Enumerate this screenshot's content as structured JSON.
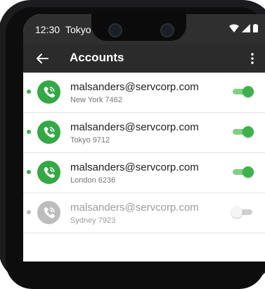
{
  "status_bar": {
    "time": "12:30",
    "city": "Tokyo"
  },
  "app_bar": {
    "title": "Accounts"
  },
  "accounts": [
    {
      "email": "malsanders@servcorp.com",
      "location": "New York 7462",
      "enabled": true
    },
    {
      "email": "malsanders@servcorp.com",
      "location": "Tokyo 9712",
      "enabled": true
    },
    {
      "email": "malsanders@servcorp.com",
      "location": "London 6236",
      "enabled": true
    },
    {
      "email": "malsanders@servcorp.com",
      "location": "Sydney 7923",
      "enabled": false
    }
  ],
  "colors": {
    "accent": "#34a844",
    "appbar": "#2b2b2b",
    "disabled": "#bdbdbd"
  },
  "icons": [
    "back-arrow-icon",
    "more-vert-icon",
    "phone-icon",
    "wifi-icon",
    "signal-icon",
    "battery-icon"
  ]
}
